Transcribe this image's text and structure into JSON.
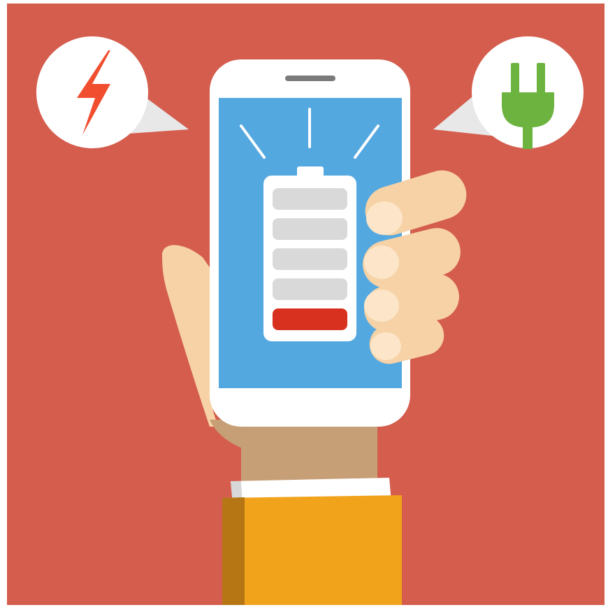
{
  "illustration": {
    "subject": "hand-holding-phone-low-battery",
    "icons": {
      "left_bubble": "lightning-bolt-icon",
      "right_bubble": "power-plug-icon",
      "screen": "battery-icon"
    },
    "battery": {
      "total_segments": 5,
      "filled_segments": 1,
      "level_fraction": 0.2,
      "status": "low"
    },
    "colors": {
      "background": "#D45D4E",
      "screen": "#54A8E0",
      "phone_body": "#FFFFFF",
      "battery_empty_segment": "#D9D9D9",
      "battery_low_segment": "#D8311F",
      "lightning": "#F04E2F",
      "plug": "#6DB33F",
      "skin": "#F6D2A6",
      "skin_shadow": "#C79F77",
      "sleeve": "#F2A31C",
      "sleeve_shadow": "#B57613",
      "cuff": "#FFFFFF"
    }
  }
}
